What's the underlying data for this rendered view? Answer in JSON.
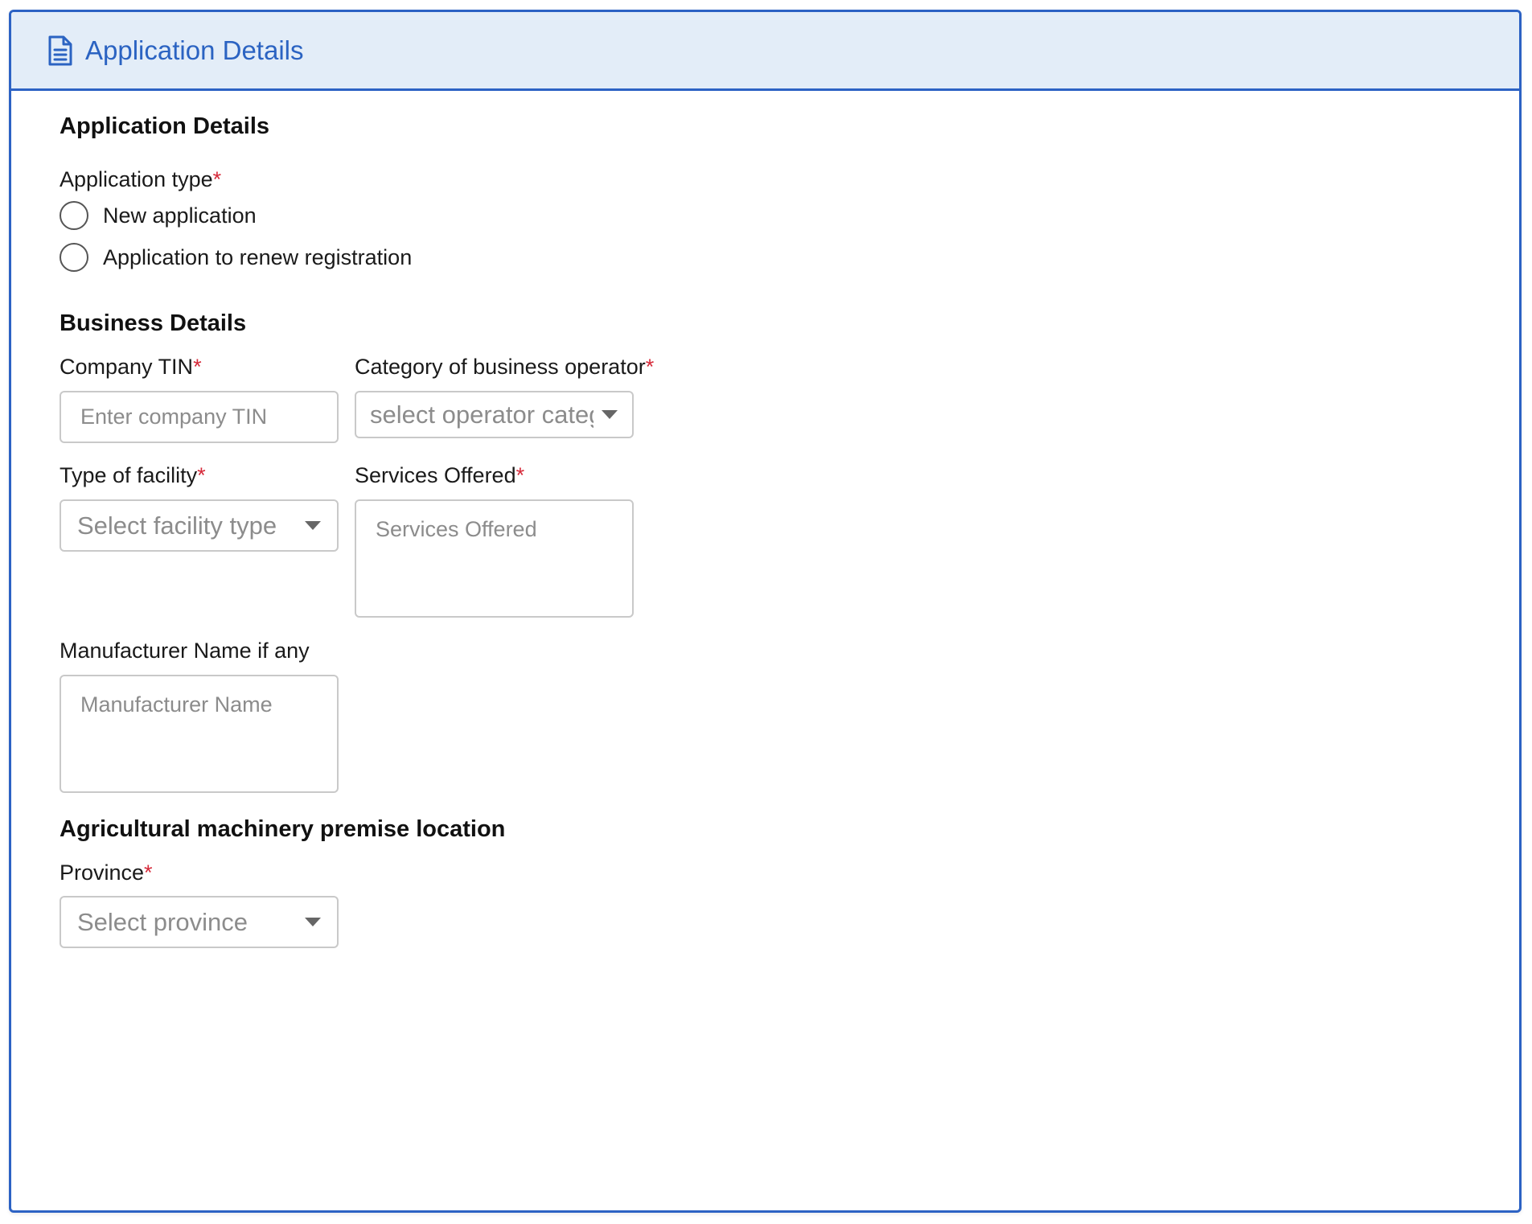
{
  "header": {
    "icon": "document-icon",
    "title": "Application Details"
  },
  "application_section": {
    "title": "Application Details",
    "application_type": {
      "label": "Application type",
      "required_mark": "*",
      "options": [
        {
          "label": "New application"
        },
        {
          "label": "Application to renew registration"
        }
      ]
    }
  },
  "business_section": {
    "title": "Business Details",
    "company_tin": {
      "label": "Company TIN",
      "required_mark": "*",
      "placeholder": "Enter company TIN",
      "value": ""
    },
    "operator_category": {
      "label": "Category of business operator",
      "required_mark": "*",
      "placeholder": "select operator category"
    },
    "facility_type": {
      "label": "Type of facility",
      "required_mark": "*",
      "placeholder": "Select facility type"
    },
    "services_offered": {
      "label": "Services Offered",
      "required_mark": "*",
      "placeholder": "Services Offered",
      "value": ""
    },
    "manufacturer_name": {
      "label": "Manufacturer Name if any",
      "placeholder": "Manufacturer Name",
      "value": ""
    }
  },
  "location_section": {
    "title": "Agricultural machinery premise location",
    "province": {
      "label": "Province",
      "required_mark": "*",
      "placeholder": "Select province"
    }
  },
  "colors": {
    "accent": "#2c62c4",
    "header_bg": "#e3edf8",
    "required": "#d62a3a",
    "border": "#c9c9c9",
    "placeholder": "#8c8c8c"
  }
}
